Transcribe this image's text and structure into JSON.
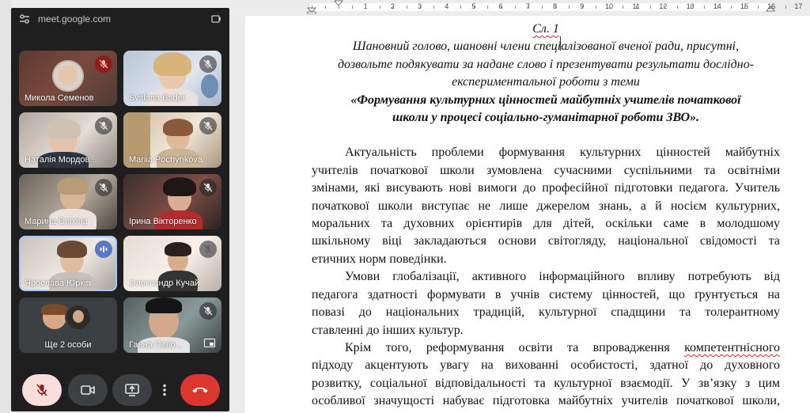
{
  "meet": {
    "url": "meet.google.com",
    "participants": [
      {
        "name": "Микола Семенов",
        "mic": "muted-red"
      },
      {
        "name": "Svitlana Bader",
        "mic": "muted"
      },
      {
        "name": "Наталія Мордов...",
        "mic": "muted"
      },
      {
        "name": "Mariia Pochynkova",
        "mic": "muted"
      },
      {
        "name": "Марина Єліхіна",
        "mic": "muted"
      },
      {
        "name": "Ірина Вікторенко",
        "mic": "muted"
      },
      {
        "name": "Ярослава Юрків",
        "mic": "speaking"
      },
      {
        "name": "Олександр Кучай",
        "mic": "muted"
      },
      {
        "name": "Ще 2 особи",
        "mic": "none"
      },
      {
        "name": "Ганна Пиво...",
        "mic": "muted"
      }
    ],
    "colors": {
      "panel": "#1f1f1f",
      "tile": "#3c4043",
      "end_call": "#dc362e",
      "mic_off_bg": "#f9dedc",
      "speaking": "#5b77c8"
    }
  },
  "ruler": {
    "numbers": [
      "1",
      "2",
      "3",
      "4",
      "5",
      "6",
      "7",
      "8",
      "9",
      "10",
      "11",
      "12",
      "13",
      "14",
      "15",
      "16",
      "17"
    ]
  },
  "document": {
    "slide_label": "Сл. 1",
    "greeting_1": "Шановний голово, шановні члени спеціалізованої вченої ради, присутні,",
    "greeting_2": "дозвольте подякувати за надане слово і презентувати результати дослідно-",
    "greeting_3": "експериментальної роботи з теми",
    "title_1": "«Формування культурних цінностей майбутніх учителів початкової",
    "title_2": "школи у процесі соціально-гуманітарної роботи ЗВО».",
    "p1": [
      "Актуальність проблеми формування культурних цінностей майбутніх",
      "учителів початкової школи зумовлена сучасними суспільними та освітніми",
      "змінами, які висувають нові вимоги до професійної підготовки педагога. Учитель",
      "початкової школи виступає не лише джерелом знань, а й носієм культурних,",
      "моральних та духовних орієнтирів для дітей, оскільки саме в молодшому",
      "шкільному віці закладаються основи світогляду, національної свідомості та",
      "етичних норм поведінки."
    ],
    "p2": [
      "Умови глобалізації, активного інформаційного впливу потребують від",
      "педагога здатності формувати в учнів систему цінностей, що ґрунтується на",
      "повазі до національних традицій, культурної спадщини та толерантному",
      "ставленні до інших культур."
    ],
    "p3_line1_a": "Крім того, реформування освіти та впровадження ",
    "p3_line1_b": "компетентнісного",
    "p3": [
      "підходу акцентують увагу на вихованні особистості, здатної до духовного",
      "розвитку, соціальної відповідальності та культурної взаємодії. У зв’язку з цим",
      "особливої значущості набуває підготовка майбутніх учителів початкової школи,"
    ]
  }
}
